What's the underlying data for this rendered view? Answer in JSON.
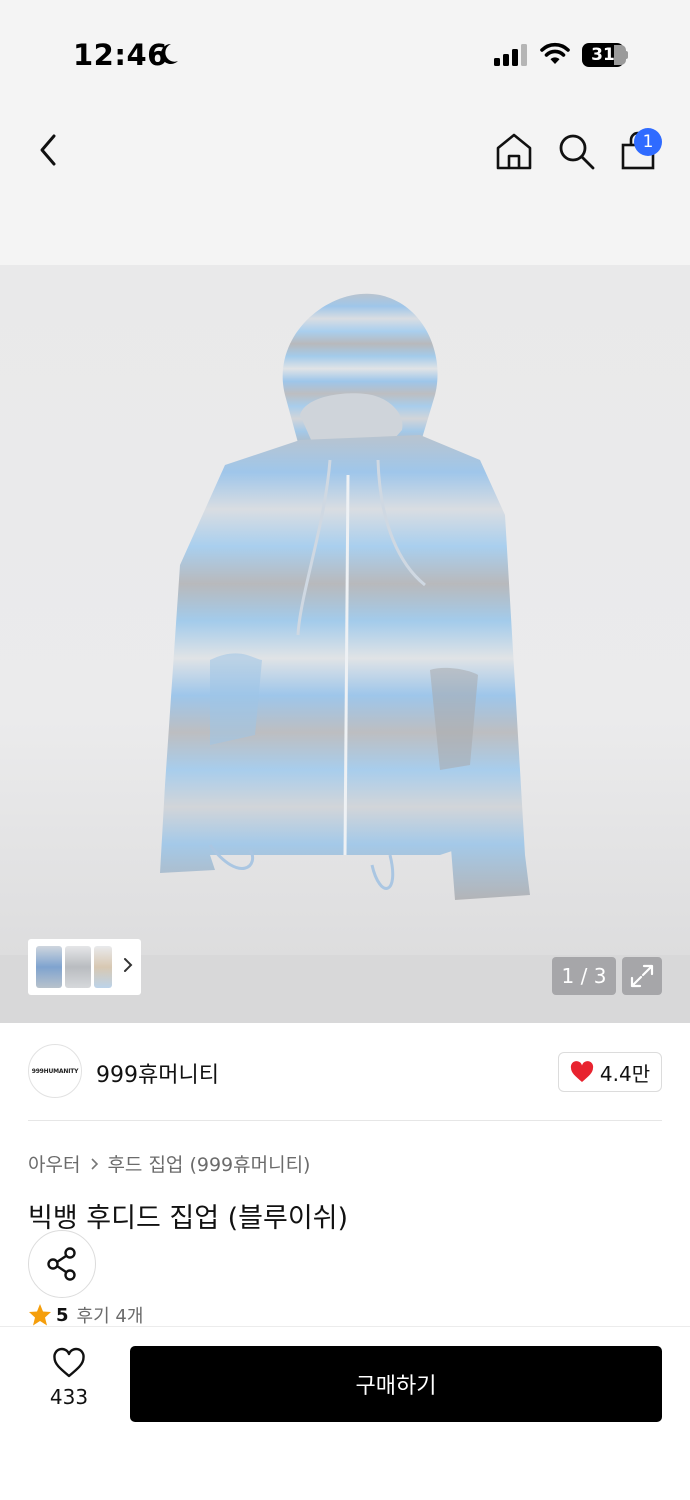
{
  "status_bar": {
    "time": "12:46",
    "battery": "31",
    "icons": [
      "moon-icon",
      "signal-icon",
      "wifi-icon",
      "battery-icon"
    ]
  },
  "nav": {
    "icons": [
      "chevron-left-icon",
      "home-icon",
      "search-icon",
      "shopping-bag-icon"
    ],
    "cart_badge": "1",
    "badge_color": "#2f6bff"
  },
  "gallery": {
    "page_counter": "1 / 3",
    "icons": [
      "chevron-right-icon",
      "expand-icon"
    ]
  },
  "brand": {
    "logo_text": "999HUMANITY",
    "name": "999휴머니티",
    "like_count": "4.4만",
    "heart_color": "#e8232f"
  },
  "product": {
    "breadcrumb": [
      "아우터",
      "후드 집업 (999휴머니티)"
    ],
    "title": "빅뱅 후디드 집업 (블루이쉬)",
    "rating": "5",
    "review_count": "후기 4개",
    "star_color": "#f59e0b"
  },
  "bottom_bar": {
    "wish_count": "433",
    "buy_label": "구매하기"
  }
}
